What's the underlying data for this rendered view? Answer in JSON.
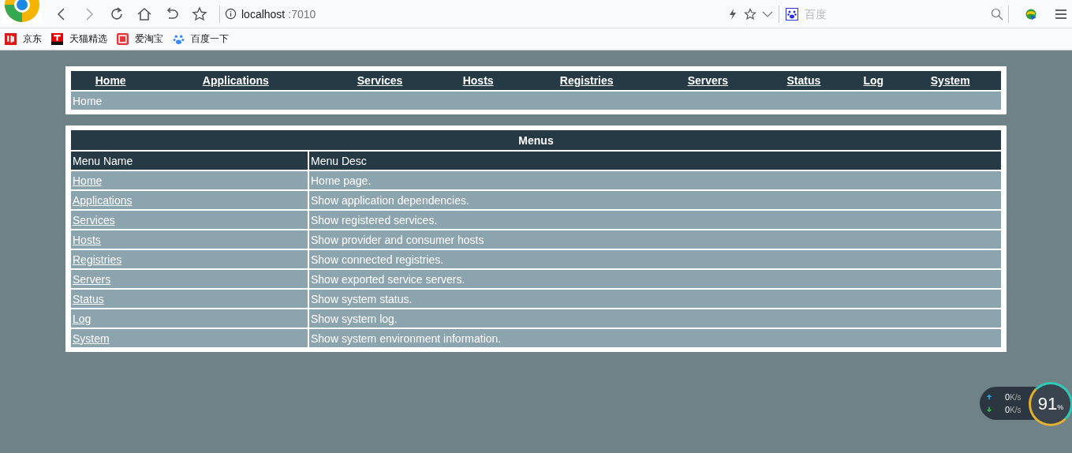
{
  "browser": {
    "host": "localhost",
    "port": ":7010",
    "search_placeholder": "百度"
  },
  "bookmarks": [
    {
      "label": "京东",
      "kind": "jd"
    },
    {
      "label": "天猫精选",
      "kind": "tmall"
    },
    {
      "label": "爱淘宝",
      "kind": "taobao"
    },
    {
      "label": "百度一下",
      "kind": "baidu"
    }
  ],
  "nav": [
    "Home",
    "Applications",
    "Services",
    "Hosts",
    "Registries",
    "Servers",
    "Status",
    "Log",
    "System"
  ],
  "breadcrumb": "Home",
  "menus": {
    "title": "Menus",
    "columns": [
      "Menu Name",
      "Menu Desc"
    ],
    "rows": [
      {
        "name": "Home",
        "desc": "Home page."
      },
      {
        "name": "Applications",
        "desc": "Show application dependencies."
      },
      {
        "name": "Services",
        "desc": "Show registered services."
      },
      {
        "name": "Hosts",
        "desc": "Show provider and consumer hosts"
      },
      {
        "name": "Registries",
        "desc": "Show connected registries."
      },
      {
        "name": "Servers",
        "desc": "Show exported service servers."
      },
      {
        "name": "Status",
        "desc": "Show system status."
      },
      {
        "name": "Log",
        "desc": "Show system log."
      },
      {
        "name": "System",
        "desc": "Show system environment information."
      }
    ]
  },
  "speed_widget": {
    "upload": "0",
    "upload_unit": "K/s",
    "download": "0",
    "download_unit": "K/s",
    "percent": "91",
    "percent_sign": "%"
  }
}
